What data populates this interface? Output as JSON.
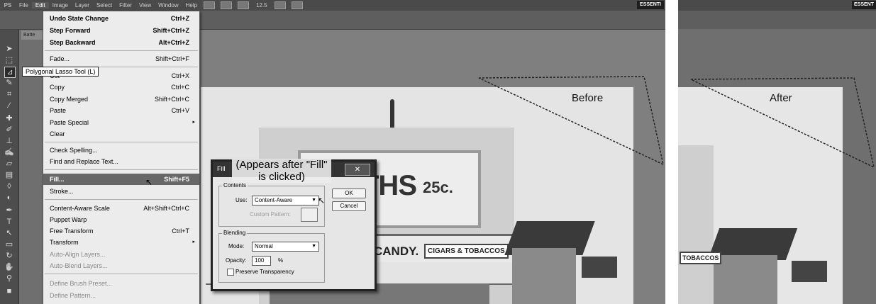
{
  "app": {
    "logo": "PS",
    "menubar": [
      "File",
      "Edit",
      "Image",
      "Layer",
      "Select",
      "Filter",
      "View",
      "Window",
      "Help"
    ],
    "active_menu": "Edit",
    "zoom": "12.5",
    "workspace": "ESSENTI",
    "workspace_right": "ESSENT",
    "doc_tab": "Batte"
  },
  "tooltip": "Polygonal Lasso Tool (L)",
  "edit_menu": {
    "items": [
      {
        "label": "Undo State Change",
        "shortcut": "Ctrl+Z",
        "style": "bold"
      },
      {
        "label": "Step Forward",
        "shortcut": "Shift+Ctrl+Z",
        "style": "bold"
      },
      {
        "label": "Step Backward",
        "shortcut": "Alt+Ctrl+Z",
        "style": "bold"
      },
      {
        "label": "Fade...",
        "shortcut": "Shift+Ctrl+F",
        "style": "normal"
      },
      {
        "label": "Cut",
        "shortcut": "Ctrl+X",
        "style": "normal"
      },
      {
        "label": "Copy",
        "shortcut": "Ctrl+C",
        "style": "normal"
      },
      {
        "label": "Copy Merged",
        "shortcut": "Shift+Ctrl+C",
        "style": "normal"
      },
      {
        "label": "Paste",
        "shortcut": "Ctrl+V",
        "style": "normal"
      },
      {
        "label": "Paste Special",
        "shortcut": "",
        "style": "normal"
      },
      {
        "label": "Clear",
        "shortcut": "",
        "style": "normal"
      },
      {
        "label": "Check Spelling...",
        "shortcut": "",
        "style": "normal"
      },
      {
        "label": "Find and Replace Text...",
        "shortcut": "",
        "style": "normal"
      },
      {
        "label": "Fill...",
        "shortcut": "Shift+F5",
        "style": "highlighted"
      },
      {
        "label": "Stroke...",
        "shortcut": "",
        "style": "normal"
      },
      {
        "label": "Content-Aware Scale",
        "shortcut": "Alt+Shift+Ctrl+C",
        "style": "normal"
      },
      {
        "label": "Puppet Warp",
        "shortcut": "",
        "style": "normal"
      },
      {
        "label": "Free Transform",
        "shortcut": "Ctrl+T",
        "style": "normal"
      },
      {
        "label": "Transform",
        "shortcut": "",
        "style": "normal"
      },
      {
        "label": "Auto-Align Layers...",
        "shortcut": "",
        "style": "disabled"
      },
      {
        "label": "Auto-Blend Layers...",
        "shortcut": "",
        "style": "disabled"
      },
      {
        "label": "Define Brush Preset...",
        "shortcut": "",
        "style": "disabled"
      },
      {
        "label": "Define Pattern...",
        "shortcut": "",
        "style": "disabled"
      }
    ]
  },
  "fill_dialog": {
    "title": "Fill",
    "annotation": "(Appears after \"Fill\" is clicked)",
    "close_symbol": "✕",
    "contents_group": "Contents",
    "use_label": "Use:",
    "use_value": "Content-Aware",
    "custom_pattern_label": "Custom Pattern:",
    "blending_group": "Blending",
    "mode_label": "Mode:",
    "mode_value": "Normal",
    "opacity_label": "Opacity:",
    "opacity_value": "100",
    "opacity_unit": "%",
    "preserve_label": "Preserve Transparency",
    "ok_label": "OK",
    "cancel_label": "Cancel"
  },
  "photo": {
    "sign_main": "THS",
    "sign_price": "25c.",
    "candy": "CANDY.",
    "cigars": "CIGARS & TOBACCOS",
    "tobaccos_right": "TOBACCOS"
  },
  "labels": {
    "before": "Before",
    "after": "After"
  }
}
